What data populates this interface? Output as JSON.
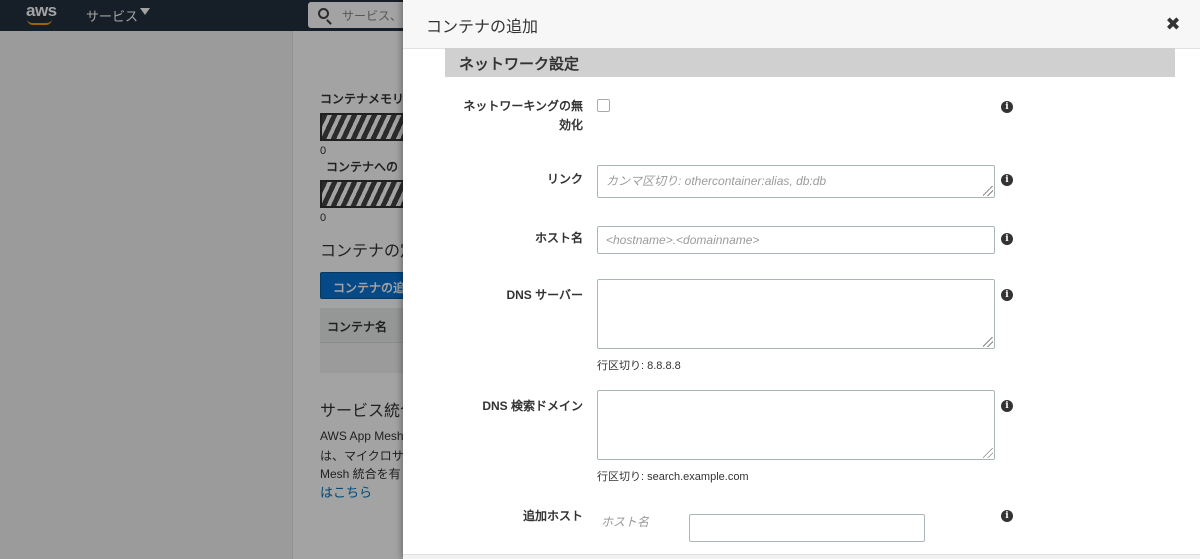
{
  "nav": {
    "logo": "aws",
    "services_label": "サービス",
    "search_placeholder": "サービス、"
  },
  "background": {
    "memory_label": "コンテナメモリ",
    "memory_zero": "0",
    "cpu_label": "コンテナへの",
    "cpu_zero": "0",
    "definitions_heading": "コンテナの定",
    "add_button": "コンテナの追",
    "table_header": "コンテナ名",
    "integration_heading": "サービス統合",
    "integration_lines": [
      "AWS App Mesh",
      "は、マイクロサ",
      "Mesh 統合を有"
    ],
    "link_text": "はこちら"
  },
  "modal": {
    "title": "コンテナの追加",
    "close_glyph": "✖",
    "section_title": "ネットワーク設定",
    "fields": {
      "disable_networking_label_1": "ネットワーキングの無",
      "disable_networking_label_2": "効化",
      "links_label": "リンク",
      "links_placeholder": "カンマ区切り: othercontainer:alias, db:db",
      "hostname_label": "ホスト名",
      "hostname_placeholder": "<hostname>.<domainname>",
      "dns_servers_label": "DNS サーバー",
      "dns_servers_hint": "行区切り: 8.8.8.8",
      "dns_search_label": "DNS 検索ドメイン",
      "dns_search_hint": "行区切り: search.example.com",
      "extra_hosts_label": "追加ホスト",
      "extra_hosts_host_placeholder": "ホスト名"
    },
    "info_glyph": "i"
  },
  "colors": {
    "nav_bg": "#232f3e",
    "brand_orange": "#ff9900",
    "primary_button": "#0972d3",
    "section_bar": "#d0d0d0"
  }
}
